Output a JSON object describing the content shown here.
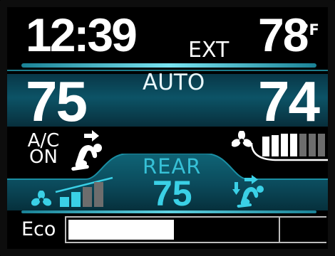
{
  "header": {
    "time": "12:39",
    "ext_label": "EXT",
    "ext_temp": "78",
    "ext_unit": "°F"
  },
  "front": {
    "mode": "AUTO",
    "driver_temp": "75",
    "passenger_temp": "74",
    "ac_line1": "A/C",
    "ac_line2": "ON",
    "airflow_icon": "face-vent-icon",
    "fan_icon": "fan-icon",
    "fan_level": 4,
    "fan_levels_total": 7
  },
  "rear": {
    "label": "REAR",
    "temp": "75",
    "fan_icon": "fan-icon",
    "fan_level": 2,
    "fan_levels_total": 4,
    "airflow_icon": "face-and-feet-vent-icon"
  },
  "eco": {
    "label": "Eco",
    "level_fraction": 0.5
  },
  "colors": {
    "accent": "#3ad0e6",
    "band": "#0c5366",
    "bar_on": "#ffffff",
    "bar_off": "#6d6d6d",
    "rear_bar_on": "#3ad0e6"
  }
}
